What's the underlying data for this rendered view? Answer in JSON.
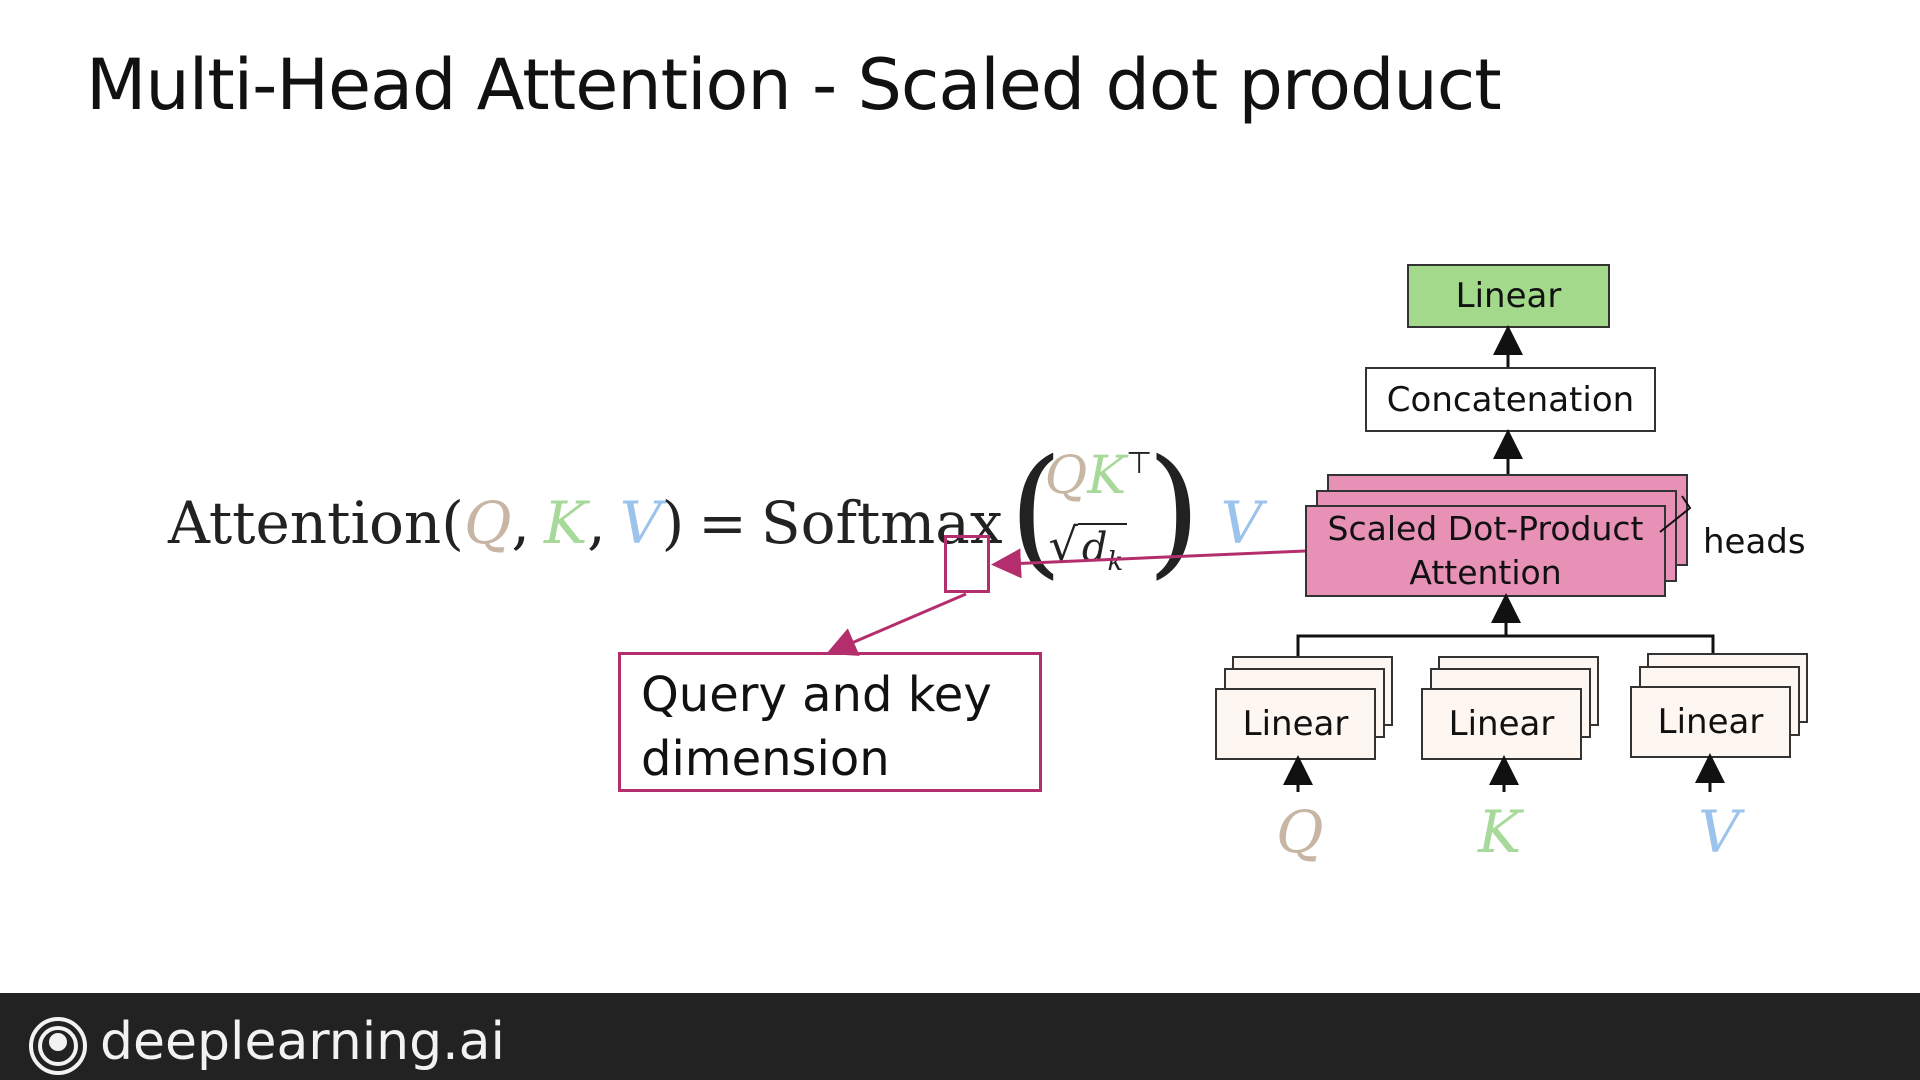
{
  "title": "Multi-Head Attention - Scaled dot product",
  "formula": {
    "lhs_fn": "Attention",
    "open_paren": "(",
    "q": "Q",
    "comma1": ",",
    "k": "K",
    "comma2": ",",
    "v": "V",
    "close_paren": ")",
    "equals": "=",
    "softmax": "Softmax",
    "num_q": "Q",
    "num_k": "K",
    "num_transpose": "⊤",
    "den_radical": "√",
    "den_d": "d",
    "den_sub": "k",
    "big_open": "(",
    "big_close": ")",
    "rhs_v": "V"
  },
  "callout": {
    "line1": "Query and key",
    "line2": "dimension"
  },
  "diagram": {
    "linear_top": "Linear",
    "concat": "Concatenation",
    "sdpa_line1": "Scaled Dot-Product",
    "sdpa_line2": "Attention",
    "heads": "heads",
    "linear_q": "Linear",
    "linear_k": "Linear",
    "linear_v": "Linear",
    "input_q": "Q",
    "input_k": "K",
    "input_v": "V"
  },
  "colors": {
    "q": "#c7b6a3",
    "k": "#a7d99a",
    "v": "#9cc3ec",
    "linear_green": "#a2d98a",
    "attention_pink": "#e891b7",
    "highlight": "#b42e6e",
    "footer_bg": "#222222"
  },
  "footer": {
    "brand": "deeplearning.ai",
    "logo_icon": "spiral-logo-icon"
  }
}
